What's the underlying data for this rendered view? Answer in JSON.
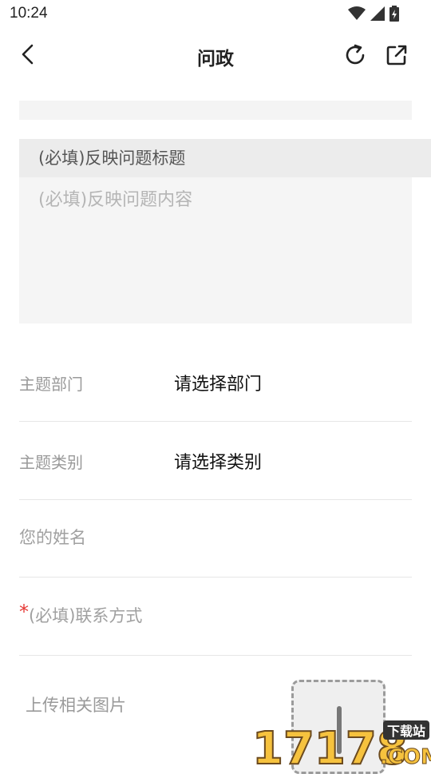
{
  "status_bar": {
    "time": "10:24"
  },
  "header": {
    "title": "问政"
  },
  "form": {
    "title_placeholder": "(必填)反映问题标题",
    "content_placeholder": "(必填)反映问题内容",
    "department": {
      "label": "主题部门",
      "value": "请选择部门"
    },
    "category": {
      "label": "主题类别",
      "value": "请选择类别"
    },
    "name_placeholder": "您的姓名",
    "contact": {
      "required_mark": "*",
      "placeholder": "(必填)联系方式"
    },
    "upload_label": "上传相关图片"
  },
  "watermark": {
    "number": "17178",
    "domain": ".COM",
    "tag": "下载站"
  },
  "colors": {
    "accent_red": "#e53935",
    "field_bg": "#f5f5f5",
    "divider": "#e6e6e6"
  }
}
